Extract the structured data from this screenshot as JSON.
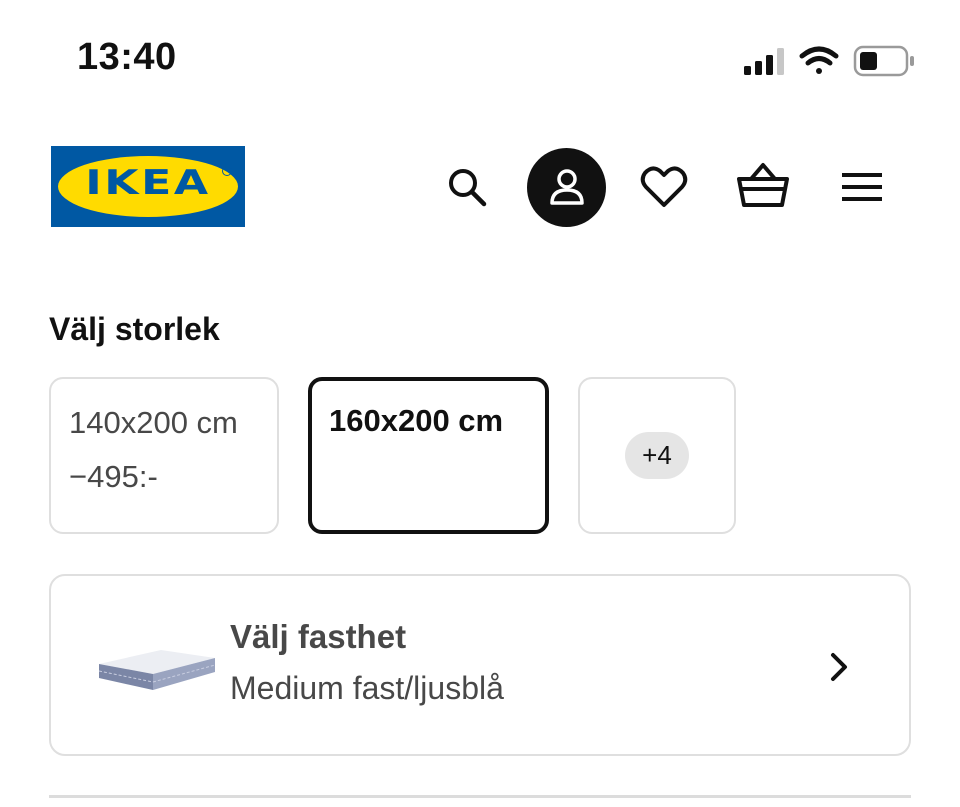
{
  "status_bar": {
    "time": "13:40",
    "icons": [
      "signal-icon",
      "wifi-icon",
      "battery-icon"
    ]
  },
  "header": {
    "logo_text": "IKEA",
    "icons": [
      "search-icon",
      "profile-icon",
      "heart-icon",
      "cart-icon",
      "menu-icon"
    ]
  },
  "size_section": {
    "title": "Välj storlek",
    "options": [
      {
        "label": "140x200 cm",
        "price": "−495:-",
        "selected": false
      },
      {
        "label": "160x200 cm",
        "price": "",
        "selected": true
      }
    ],
    "more_label": "+4"
  },
  "firmness": {
    "title": "Välj fasthet",
    "value": "Medium fast/ljusblå"
  },
  "colors": {
    "brand_blue": "#0058a3",
    "brand_yellow": "#ffdb00",
    "text_primary": "#111111",
    "text_secondary": "#484848",
    "border": "#dfdfdf",
    "badge_bg": "#e5e5e5"
  }
}
